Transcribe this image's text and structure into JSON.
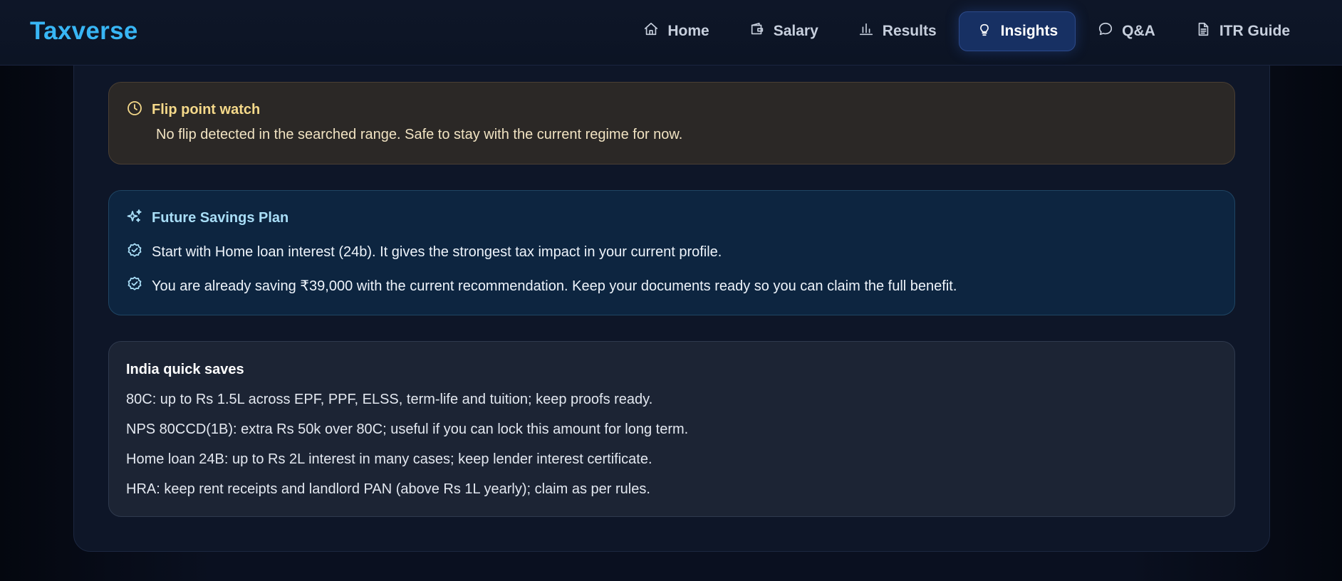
{
  "app": {
    "logo": "Taxverse"
  },
  "nav": {
    "items": [
      {
        "label": "Home",
        "icon": "home-icon",
        "active": false
      },
      {
        "label": "Salary",
        "icon": "wallet-icon",
        "active": false
      },
      {
        "label": "Results",
        "icon": "bar-chart-icon",
        "active": false
      },
      {
        "label": "Insights",
        "icon": "lightbulb-icon",
        "active": true
      },
      {
        "label": "Q&A",
        "icon": "chat-bubble-icon",
        "active": false
      },
      {
        "label": "ITR Guide",
        "icon": "document-icon",
        "active": false
      }
    ]
  },
  "flip": {
    "title": "Flip point watch",
    "text": "No flip detected in the searched range. Safe to stay with the current regime for now.",
    "icon": "clock-icon"
  },
  "future": {
    "title": "Future Savings Plan",
    "icon": "sparkles-icon",
    "items": [
      "Start with Home loan interest (24b). It gives the strongest tax impact in your current profile.",
      "You are already saving ₹39,000 with the current recommendation. Keep your documents ready so you can claim the full benefit."
    ]
  },
  "quick": {
    "title": "India quick saves",
    "items": [
      "80C: up to Rs 1.5L across EPF, PPF, ELSS, term-life and tuition; keep proofs ready.",
      "NPS 80CCD(1B): extra Rs 50k over 80C; useful if you can lock this amount for long term.",
      "Home loan 24B: up to Rs 2L interest in many cases; keep lender interest certificate.",
      "HRA: keep rent receipts and landlord PAN (above Rs 1L yearly); claim as per rules."
    ]
  },
  "colors": {
    "accent": "#38b6f5",
    "nav_active_bg": "#173063",
    "flip_title": "#f5d98a",
    "future_title": "#a9def7"
  }
}
